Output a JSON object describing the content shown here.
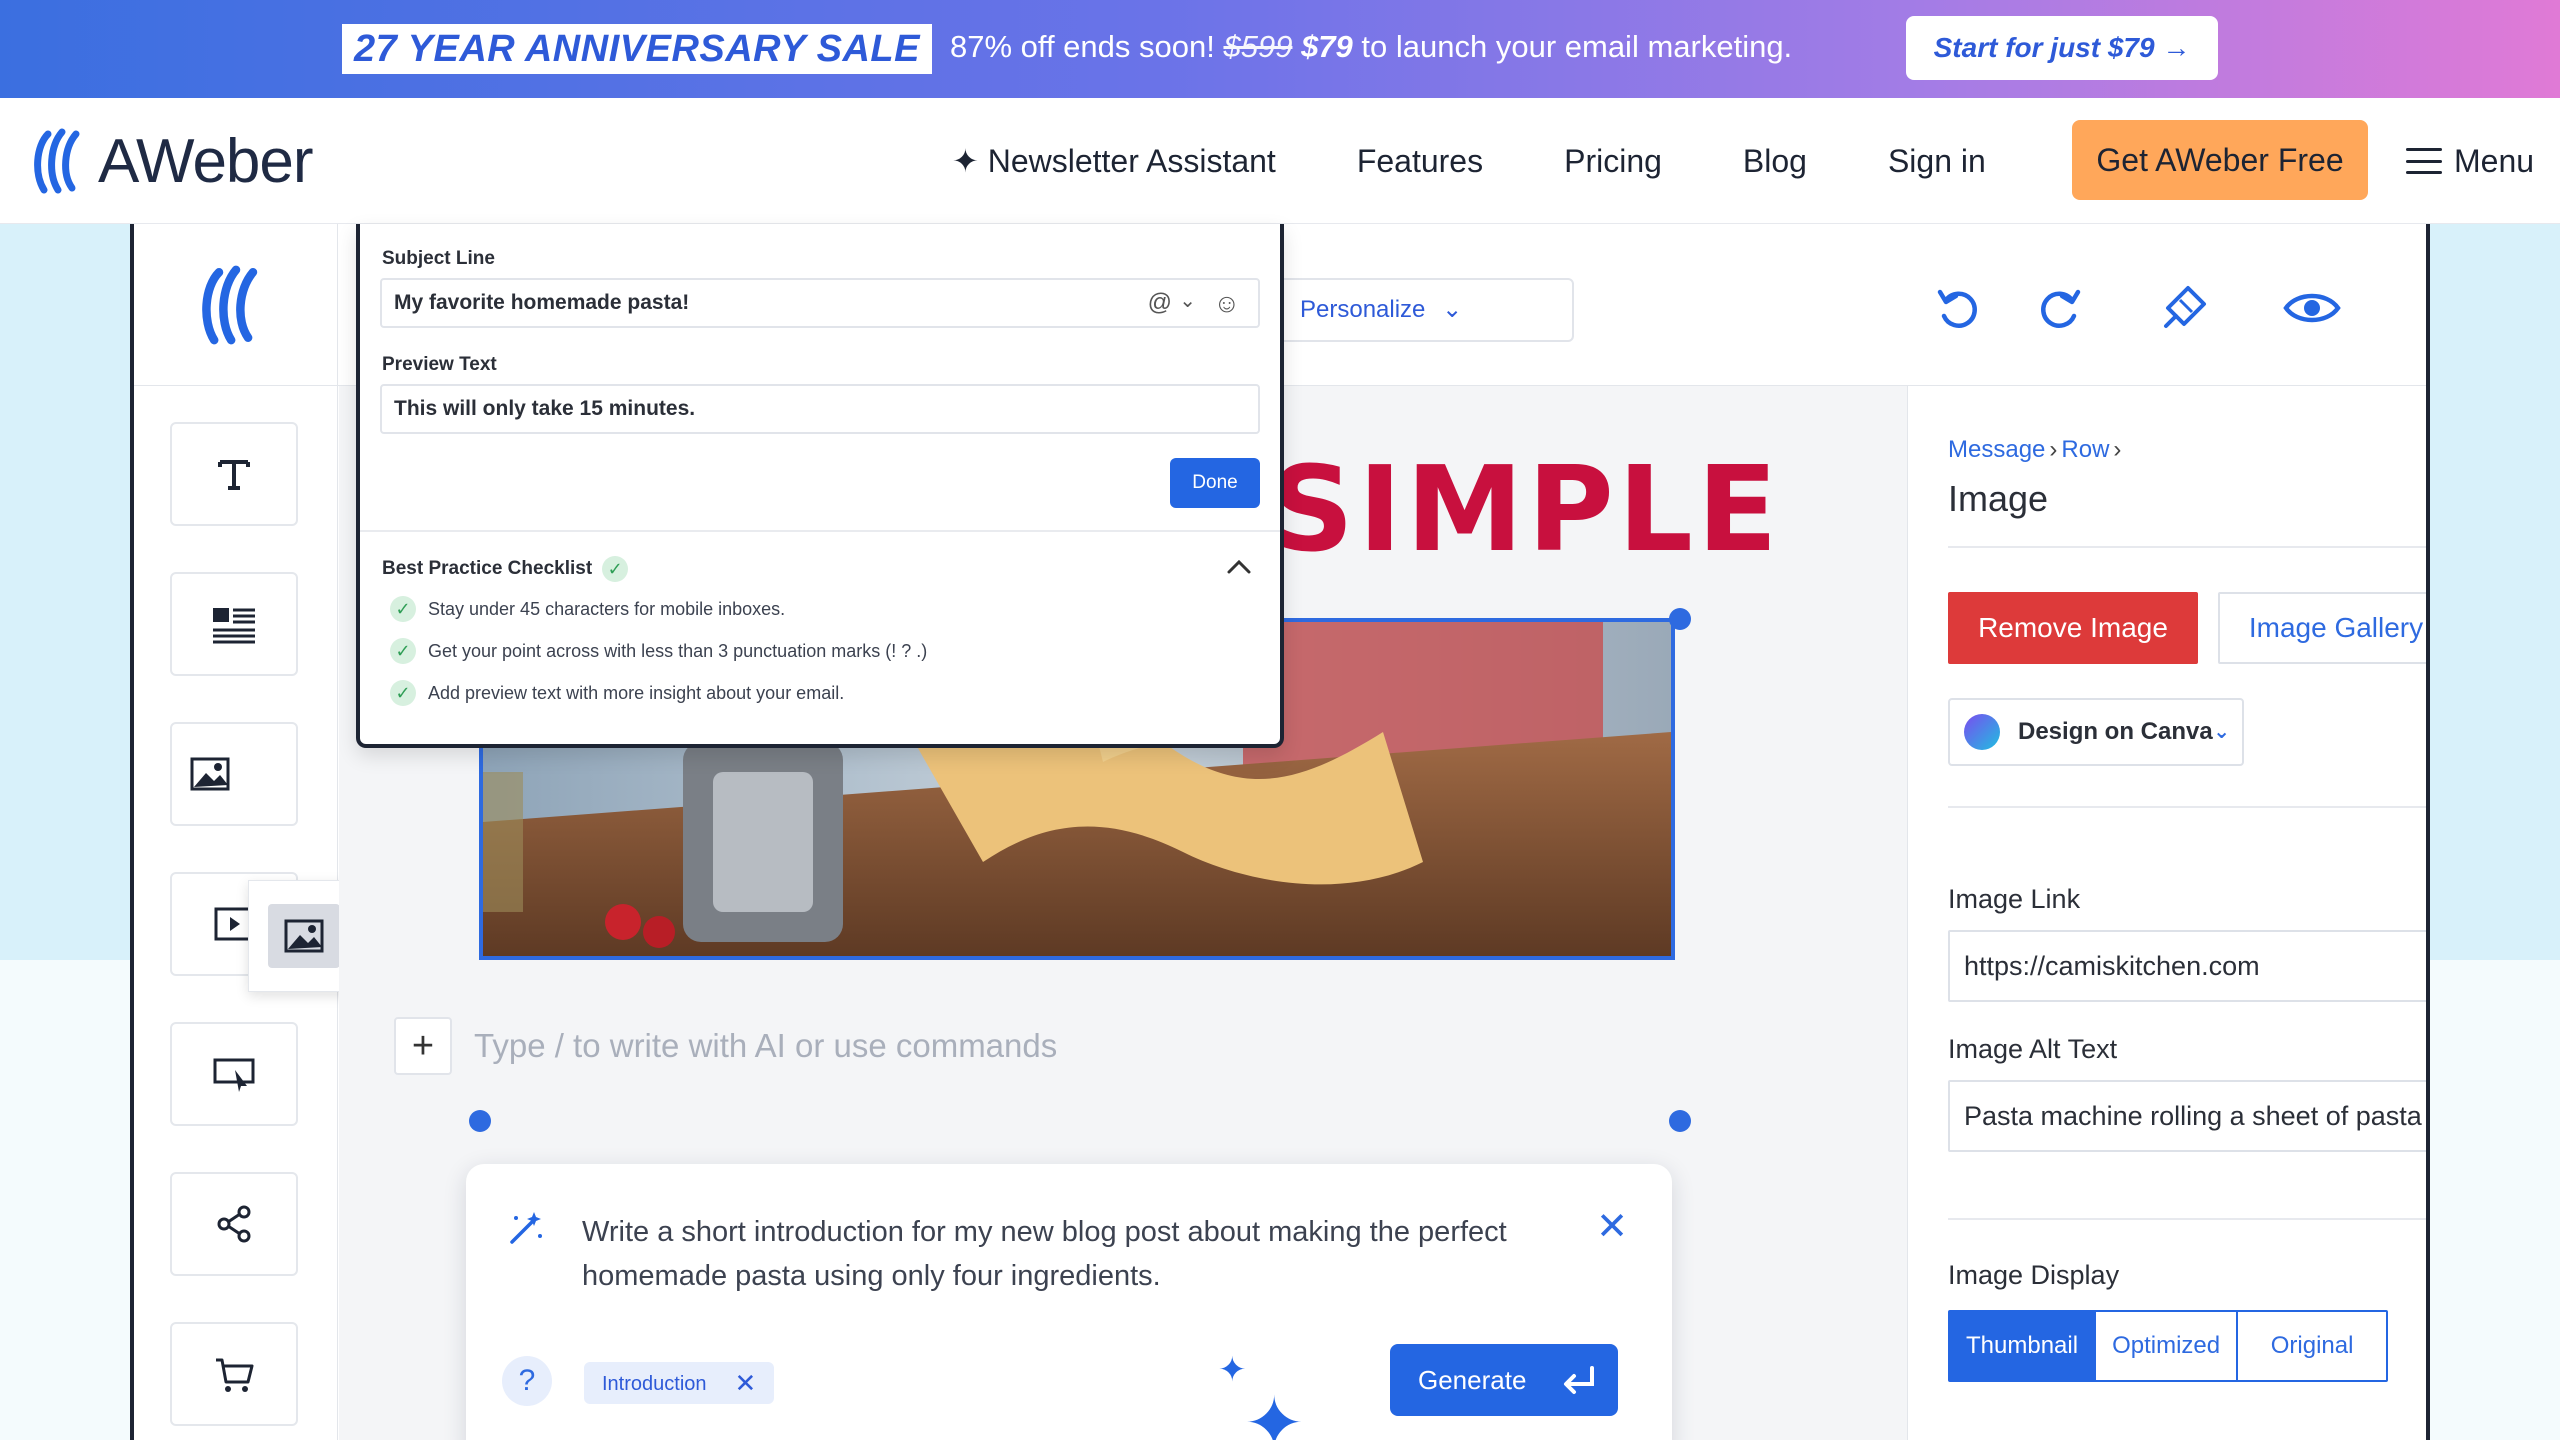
{
  "promo": {
    "sale": "27 YEAR ANNIVERSARY SALE",
    "msg_pre": "87% off ends soon! ",
    "old_price": "$599",
    "new_price": "$79",
    "msg_post": " to launch your email marketing.",
    "cta": "Start for just $79 →"
  },
  "nav": {
    "logo": "AWeber",
    "links": [
      "✦ Newsletter Assistant",
      "Features",
      "Pricing",
      "Blog",
      "Sign in"
    ],
    "cta": "Get AWeber Free",
    "menu": "Menu"
  },
  "editor": {
    "personalize": "Personalize",
    "subject_label": "Subject Line",
    "subject_value": "My favorite homemade pasta!",
    "preview_label": "Preview Text",
    "preview_value": "This will only take 15 minutes.",
    "done": "Done",
    "checklist_title": "Best Practice Checklist",
    "checklist": [
      "Stay under 45 characters for mobile inboxes.",
      "Get your point across with less than 3 punctuation marks (! ? .)",
      "Add preview text with more insight about your email."
    ],
    "headline": "SIMPLE",
    "type_placeholder": "Type / to write with AI or use commands",
    "ai_prompt": "Write a short introduction for my new blog post about making the perfect homemade pasta using only four ingredients.",
    "ai_help": "?",
    "ai_chip": "Introduction",
    "ai_generate": "Generate"
  },
  "panel": {
    "crumb_message": "Message",
    "crumb_row": "Row",
    "title": "Image",
    "remove": "Remove Image",
    "gallery": "Image Gallery",
    "canva": "Design on Canva",
    "link_label": "Image Link",
    "link_value": "https://camiskitchen.com",
    "alt_label": "Image Alt Text",
    "alt_value": "Pasta machine rolling a sheet of pasta",
    "display_label": "Image Display",
    "display_options": [
      "Thumbnail",
      "Optimized",
      "Original"
    ],
    "display_selected": "Thumbnail"
  },
  "colors": {
    "accent": "#2466e2",
    "cta_orange": "#ffa75a",
    "danger": "#dd3a3a",
    "headline_red": "#c8103e"
  },
  "icons": [
    "aweber-logo-icon",
    "text-block-icon",
    "article-block-icon",
    "image-block-icon",
    "video-block-icon",
    "button-block-icon",
    "social-share-icon",
    "cart-icon",
    "undo-icon",
    "redo-icon",
    "design-brush-icon",
    "preview-eye-icon",
    "grab-hand-icon",
    "ai-wand-icon",
    "close-icon",
    "enter-icon",
    "sparkle-icon",
    "canva-icon",
    "chevron-down-icon",
    "menu-icon",
    "check-icon"
  ]
}
